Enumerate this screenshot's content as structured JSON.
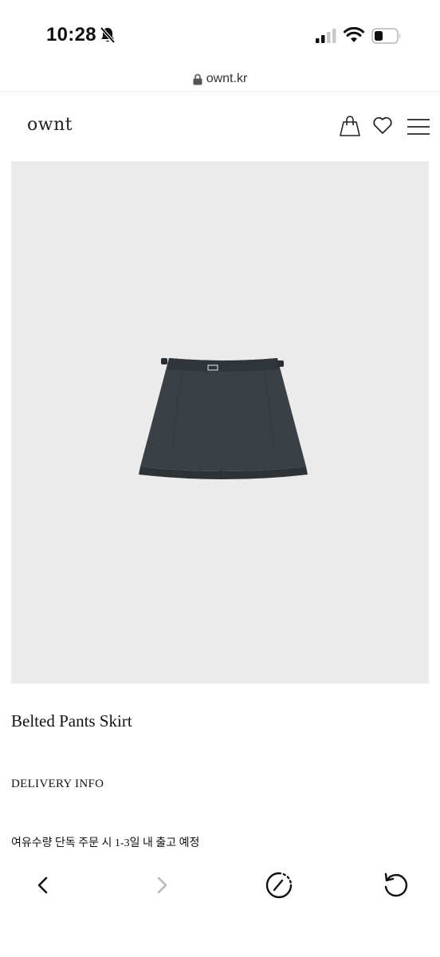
{
  "status_bar": {
    "time": "10:28",
    "icons": [
      "bell-slash-icon",
      "cellular-signal-icon",
      "wifi-icon",
      "battery-icon"
    ]
  },
  "url_bar": {
    "domain": "ownt.kr",
    "icon": "lock-icon"
  },
  "site_header": {
    "logo": "ownt",
    "icons": [
      "shopping-bag-icon",
      "heart-icon",
      "hamburger-menu-icon"
    ]
  },
  "product": {
    "image_background": "#ebebec",
    "skirt_color": "#3b4046",
    "title": "Belted Pants Skirt",
    "delivery_label": "DELIVERY INFO",
    "delivery_note": "여유수량 단독 주문 시 1-3일 내 출고 예정"
  },
  "toolbar": {
    "icons": [
      "chevron-left-icon",
      "chevron-right-icon",
      "speed-gauge-icon",
      "reload-icon"
    ]
  }
}
